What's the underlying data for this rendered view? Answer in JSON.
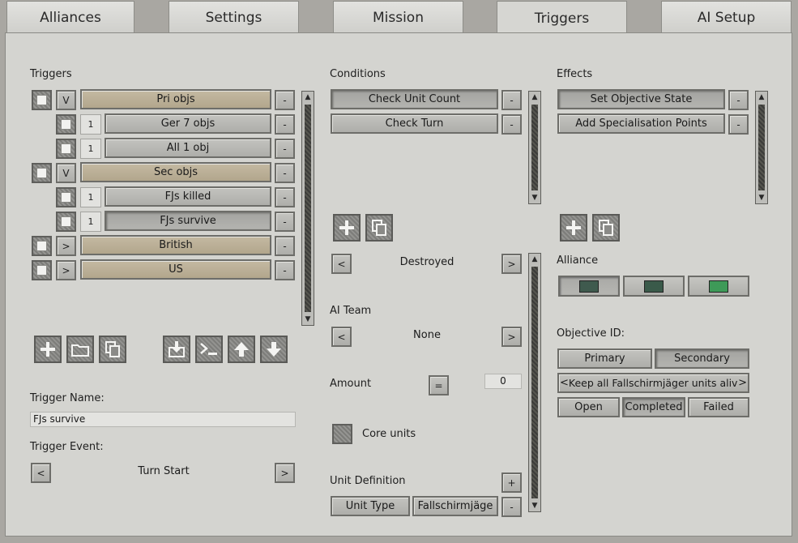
{
  "tabs": [
    "Alliances",
    "Settings",
    "Mission",
    "Triggers",
    "AI Setup"
  ],
  "active_tab": "Triggers",
  "triggers": {
    "header": "Triggers",
    "rows": [
      {
        "toggle": "V",
        "label": "Pri objs"
      },
      {
        "toggle": "1",
        "label": "Ger 7 objs"
      },
      {
        "toggle": "1",
        "label": "All 1 obj"
      },
      {
        "toggle": "V",
        "label": "Sec objs"
      },
      {
        "toggle": "1",
        "label": "FJs killed"
      },
      {
        "toggle": "1",
        "label": "FJs survive"
      },
      {
        "toggle": ">",
        "label": "British"
      },
      {
        "toggle": ">",
        "label": "US"
      }
    ],
    "remove_label": "-",
    "name_label": "Trigger Name:",
    "name_value": "FJs survive",
    "event_label": "Trigger Event:",
    "event_value": "Turn Start",
    "prev": "<",
    "next": ">"
  },
  "conditions": {
    "header": "Conditions",
    "items": [
      "Check Unit Count",
      "Check Turn"
    ],
    "remove_label": "-",
    "state_value": "Destroyed",
    "ai_team_label": "AI Team",
    "ai_team_value": "None",
    "amount_label": "Amount",
    "amount_op": "=",
    "amount_value": "0",
    "core_units_label": "Core units",
    "unit_def_label": "Unit Definition",
    "unit_def_add": "+",
    "unit_type_label": "Unit Type",
    "unit_type_value": "Fallschirmjäge",
    "prev": "<",
    "next": ">"
  },
  "effects": {
    "header": "Effects",
    "items": [
      "Set Objective State",
      "Add Specialisation Points"
    ],
    "remove_label": "-",
    "alliance_label": "Alliance",
    "alliance_colors": [
      "#3f5a4e",
      "#3a5a4a",
      "#3e9a58"
    ],
    "objective_id_label": "Objective ID:",
    "primary_label": "Primary",
    "secondary_label": "Secondary",
    "objective_text": "Keep all Fallschirmjäger units alive",
    "prev": "<",
    "next": ">",
    "open_label": "Open",
    "completed_label": "Completed",
    "failed_label": "Failed"
  }
}
